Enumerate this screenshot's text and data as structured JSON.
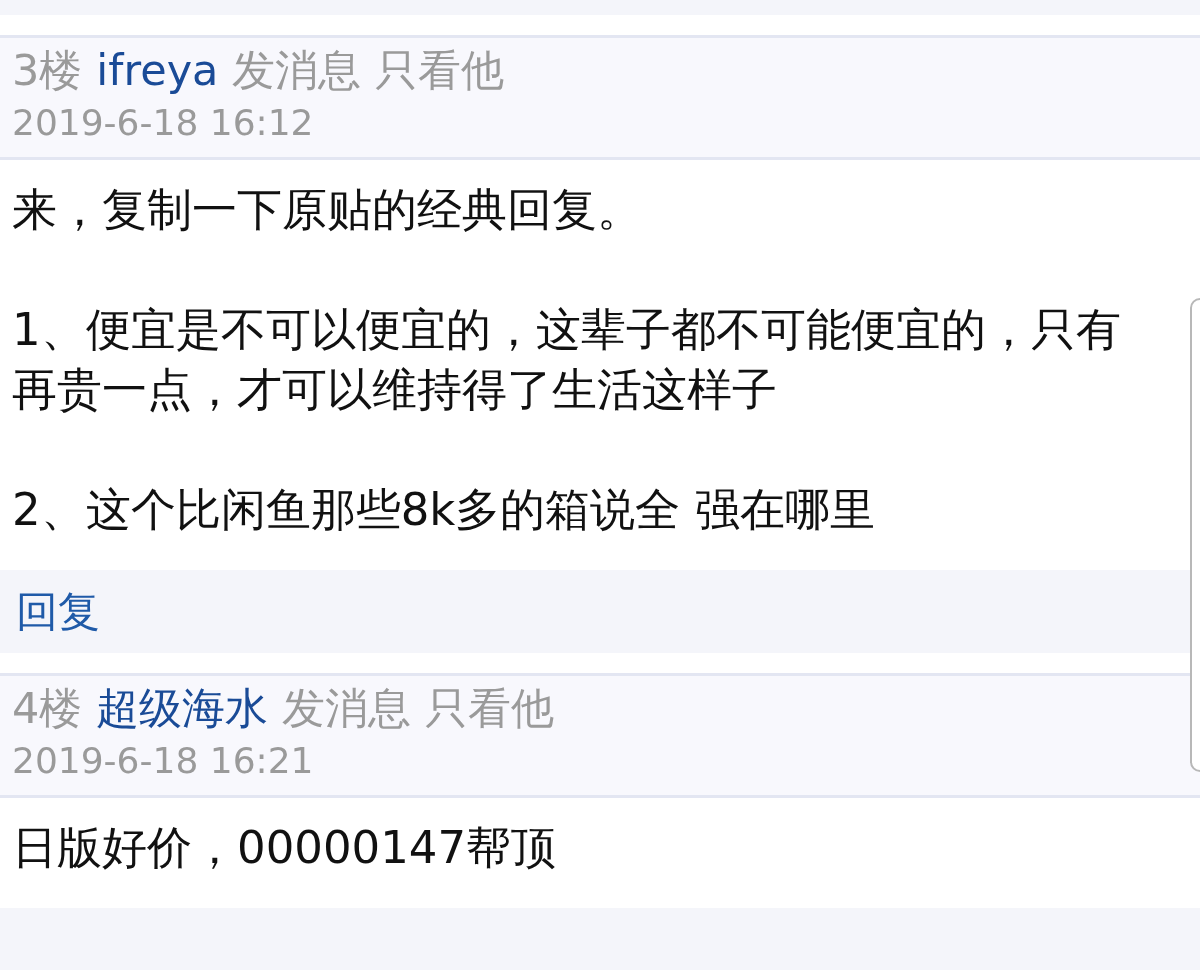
{
  "posts": [
    {
      "floor": "3楼",
      "author": "ifreya",
      "actions": [
        "发消息",
        "只看他"
      ],
      "time": "2019-6-18 16:12",
      "paragraphs": [
        "来，复制一下原贴的经典回复。",
        "1、便宜是不可以便宜的，这辈子都不可能便宜的，只有再贵一点，才可以维持得了生活这样子",
        "2、这个比闲鱼那些8k多的箱说全 强在哪里"
      ],
      "reply": "回复"
    },
    {
      "floor": "4楼",
      "author": "超级海水",
      "actions": [
        "发消息",
        "只看他"
      ],
      "time": "2019-6-18 16:21",
      "paragraphs": [
        "日版好价，00000147帮顶"
      ]
    }
  ]
}
